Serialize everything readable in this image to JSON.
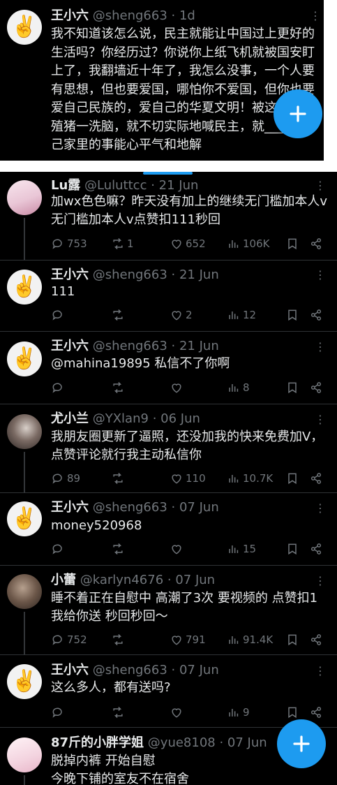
{
  "top_tweet": {
    "name": "王小六",
    "handle": "@sheng663",
    "time": "· 1d",
    "text": "我不知道该怎么说，民主就能让中国过上更好的生活吗？你经历过？你说你上纸飞机就被国安盯上了，我翻墙近十年了，我怎么没事，一个人要有思想，但也要爱国，哪怕你不爱国，但你也要爱自己民族的，爱自己的华夏文明！被这些____殖猪一洗脑，就不切实际地喊民主，就____你自己家里的事能心平气和地解",
    "avatar_icon": "peace-hand"
  },
  "tweets": [
    {
      "name": "Lu露",
      "handle": "@Luluttcc",
      "time": "· 21 Jun",
      "text": "加wx色色嘛？昨天没有加上的继续无门槛加本人v 无门槛加本人v点赞扣111秒回",
      "replies": "753",
      "retweets": "1",
      "likes": "652",
      "views": "106K",
      "avatar_icon": "anime-girl-avatar"
    },
    {
      "name": "王小六",
      "handle": "@sheng663",
      "time": "· 21 Jun",
      "text": "111",
      "replies": "",
      "retweets": "",
      "likes": "2",
      "views": "12",
      "avatar_icon": "peace-hand"
    },
    {
      "name": "王小六",
      "handle": "@sheng663",
      "time": "· 21 Jun",
      "text": "@mahina19895 私信不了你啊",
      "replies": "",
      "retweets": "",
      "likes": "",
      "views": "8",
      "avatar_icon": "peace-hand"
    },
    {
      "name": "尤小兰",
      "handle": "@YXlan9",
      "time": "· 06 Jun",
      "text": "我朋友圈更新了逼照，还没加我的快来免费加V，点赞评论就行我主动私信你",
      "replies": "89",
      "retweets": "",
      "likes": "110",
      "views": "10.7K",
      "avatar_icon": "photo-avatar"
    },
    {
      "name": "王小六",
      "handle": "@sheng663",
      "time": "· 07 Jun",
      "text": "money520968",
      "replies": "",
      "retweets": "",
      "likes": "",
      "views": "15",
      "avatar_icon": "peace-hand"
    },
    {
      "name": "小蕾",
      "handle": "@karlyn4676",
      "time": "· 07 Jun",
      "text": "睡不着正在自慰中 高潮了3次 要视频的 点赞扣1我给你送 秒回秒回～",
      "replies": "752",
      "retweets": "",
      "likes": "791",
      "views": "91.4K",
      "avatar_icon": "photo-avatar"
    },
    {
      "name": "王小六",
      "handle": "@sheng663",
      "time": "· 07 Jun",
      "text": "这么多人，都有送吗?",
      "replies": "",
      "retweets": "",
      "likes": "",
      "views": "9",
      "avatar_icon": "peace-hand"
    },
    {
      "name": "87斤的小胖学姐",
      "handle": "@yue8108",
      "time": "· 07 Jun",
      "text": "脱掉内裤 开始自慰\n今晚下铺的室友不在宿舍",
      "avatar_icon": "anime-girl-avatar"
    }
  ],
  "icons": {
    "reply": "reply-icon",
    "retweet": "retweet-icon",
    "like": "heart-icon",
    "views": "views-icon",
    "bookmark": "bookmark-icon",
    "share": "share-icon",
    "more": "more-icon",
    "compose": "compose-plus-icon"
  },
  "colors": {
    "accent": "#1d9bf0",
    "muted": "#71767b",
    "text": "#e7e9ea",
    "divider": "#2f3336"
  }
}
